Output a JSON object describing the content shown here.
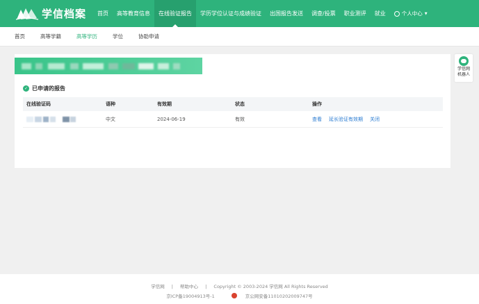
{
  "brand": {
    "name": "学信档案"
  },
  "nav": {
    "items": [
      {
        "label": "首页"
      },
      {
        "label": "高等教育信息"
      },
      {
        "label": "在线验证报告"
      },
      {
        "label": "学历学位认证与成绩验证"
      },
      {
        "label": "出国报告发送"
      },
      {
        "label": "调查/投票"
      },
      {
        "label": "职业测评"
      },
      {
        "label": "就业"
      }
    ],
    "active_index": 2,
    "user_center": "个人中心"
  },
  "subnav": {
    "items": [
      {
        "label": "首页"
      },
      {
        "label": "高等学籍"
      },
      {
        "label": "高等学历"
      },
      {
        "label": "学位"
      },
      {
        "label": "协助申请"
      }
    ],
    "active_index": 2
  },
  "section": {
    "title": "已申请的报告"
  },
  "table": {
    "headers": [
      "在线验证码",
      "语种",
      "有效期",
      "状态",
      "操作"
    ],
    "rows": [
      {
        "code": "",
        "language": "中文",
        "expiry": "2024-06-19",
        "status": "有效",
        "actions": [
          "查看",
          "延长验证有效期",
          "关闭"
        ]
      }
    ]
  },
  "bot": {
    "label_line1": "学信网",
    "label_line2": "机器人"
  },
  "footer": {
    "links": [
      "学信网",
      "|",
      "帮助中心",
      "|",
      "Copyright © 2003-2024 学信网 All Rights Reserved"
    ],
    "icp": "京ICP备19004913号-1",
    "police": "京公网安备11010202009747号"
  },
  "colors": {
    "brand_green": "#2eb37c",
    "link_blue": "#2a7bd1"
  }
}
